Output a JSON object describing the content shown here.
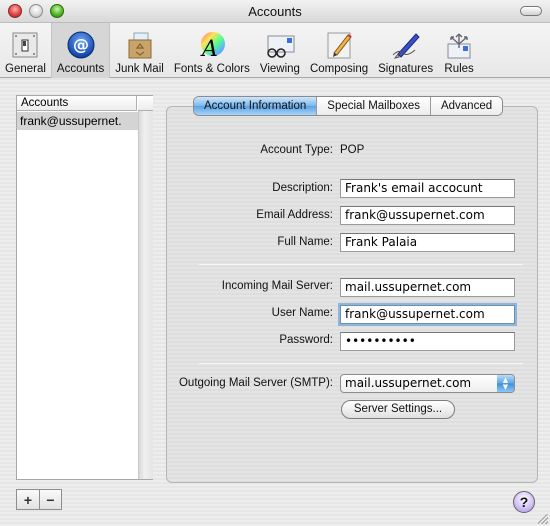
{
  "window": {
    "title": "Accounts"
  },
  "toolbar": {
    "items": [
      {
        "label": "General",
        "icon": "light-switch-icon"
      },
      {
        "label": "Accounts",
        "icon": "at-sign-icon",
        "selected": true
      },
      {
        "label": "Junk Mail",
        "icon": "recycle-box-icon"
      },
      {
        "label": "Fonts & Colors",
        "icon": "color-wheel-font-icon"
      },
      {
        "label": "Viewing",
        "icon": "glasses-envelope-icon"
      },
      {
        "label": "Composing",
        "icon": "pencil-paper-icon"
      },
      {
        "label": "Signatures",
        "icon": "fountain-pen-icon"
      },
      {
        "label": "Rules",
        "icon": "arrows-envelope-icon"
      }
    ]
  },
  "accounts_list": {
    "header": "Accounts",
    "rows": [
      "frank@ussupernet."
    ],
    "add_label": "+",
    "remove_label": "−"
  },
  "tabs": [
    {
      "label": "Account Information",
      "active": true
    },
    {
      "label": "Special Mailboxes",
      "active": false
    },
    {
      "label": "Advanced",
      "active": false
    }
  ],
  "form": {
    "account_type": {
      "label": "Account Type:",
      "value": "POP"
    },
    "description": {
      "label": "Description:",
      "value": "Frank's email accocunt"
    },
    "email_address": {
      "label": "Email Address:",
      "value": "frank@ussupernet.com"
    },
    "full_name": {
      "label": "Full Name:",
      "value": "Frank Palaia"
    },
    "incoming_server": {
      "label": "Incoming Mail Server:",
      "value": "mail.ussupernet.com"
    },
    "user_name": {
      "label": "User Name:",
      "value": "frank@ussupernet.com"
    },
    "password": {
      "label": "Password:",
      "value": "••••••••••"
    },
    "outgoing_server": {
      "label": "Outgoing Mail Server (SMTP):",
      "value": "mail.ussupernet.com"
    },
    "server_settings_button": "Server Settings..."
  },
  "help_label": "?",
  "colors": {
    "accent_blue": "#5aa2e6",
    "selected_row": "#d4d4d4",
    "close": "#e24545",
    "minimize": "#dcdcdc",
    "zoom": "#53b82a"
  }
}
